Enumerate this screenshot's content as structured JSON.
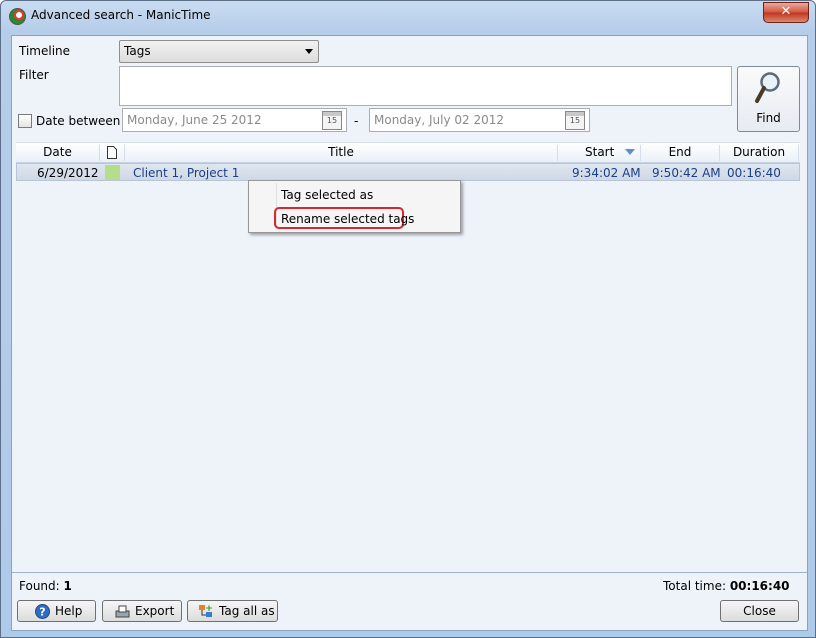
{
  "window": {
    "title": "Advanced search - ManicTime",
    "close_glyph": "✕"
  },
  "form": {
    "timeline_label": "Timeline",
    "timeline_value": "Tags",
    "filter_label": "Filter",
    "filter_value": "",
    "date_between_label": "Date between",
    "date_from": "Monday, June 25 2012",
    "date_to": "Monday, July 02 2012",
    "calendar_day": "15",
    "dash": "-",
    "find_label": "Find"
  },
  "grid": {
    "columns": [
      "Date",
      "",
      "Title",
      "Start",
      "End",
      "Duration"
    ],
    "rows": [
      {
        "date": "6/29/2012",
        "title": "Client 1, Project 1",
        "start": "9:34:02 AM",
        "end": "9:50:42 AM",
        "duration": "00:16:40"
      }
    ]
  },
  "context_menu": {
    "items": [
      "Tag selected as",
      "Rename selected tags"
    ]
  },
  "status": {
    "found_label": "Found:",
    "found_count": "1",
    "total_label": "Total time:",
    "total_value": "00:16:40"
  },
  "buttons": {
    "help": "Help",
    "export": "Export",
    "tag_all": "Tag all as",
    "close": "Close"
  },
  "icons": [
    "app-icon",
    "magnifier-icon",
    "calendar-icon",
    "document-icon",
    "sort-desc-icon",
    "help-icon",
    "export-icon",
    "tag-all-icon"
  ]
}
